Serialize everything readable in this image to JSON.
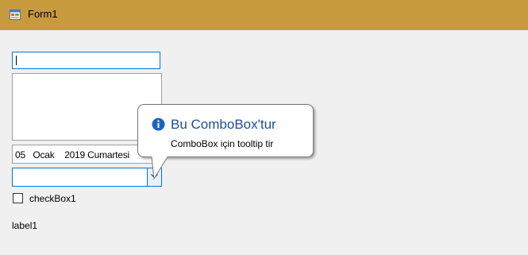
{
  "window": {
    "title": "Form1",
    "titlebar_color": "#c89a3e",
    "icon": "winforms-app-icon"
  },
  "form": {
    "textbox_value": "",
    "multiline_value": "",
    "date_picker_value": "05   Ocak    2019 Cumartesi",
    "combobox_value": "",
    "checkbox": {
      "label": "checkBox1",
      "checked": false
    },
    "label": "label1"
  },
  "tooltip": {
    "icon": "info-icon",
    "title": "Bu ComboBox'tur",
    "text": "ComboBox için tooltip tir",
    "title_color": "#1c4f9c"
  }
}
